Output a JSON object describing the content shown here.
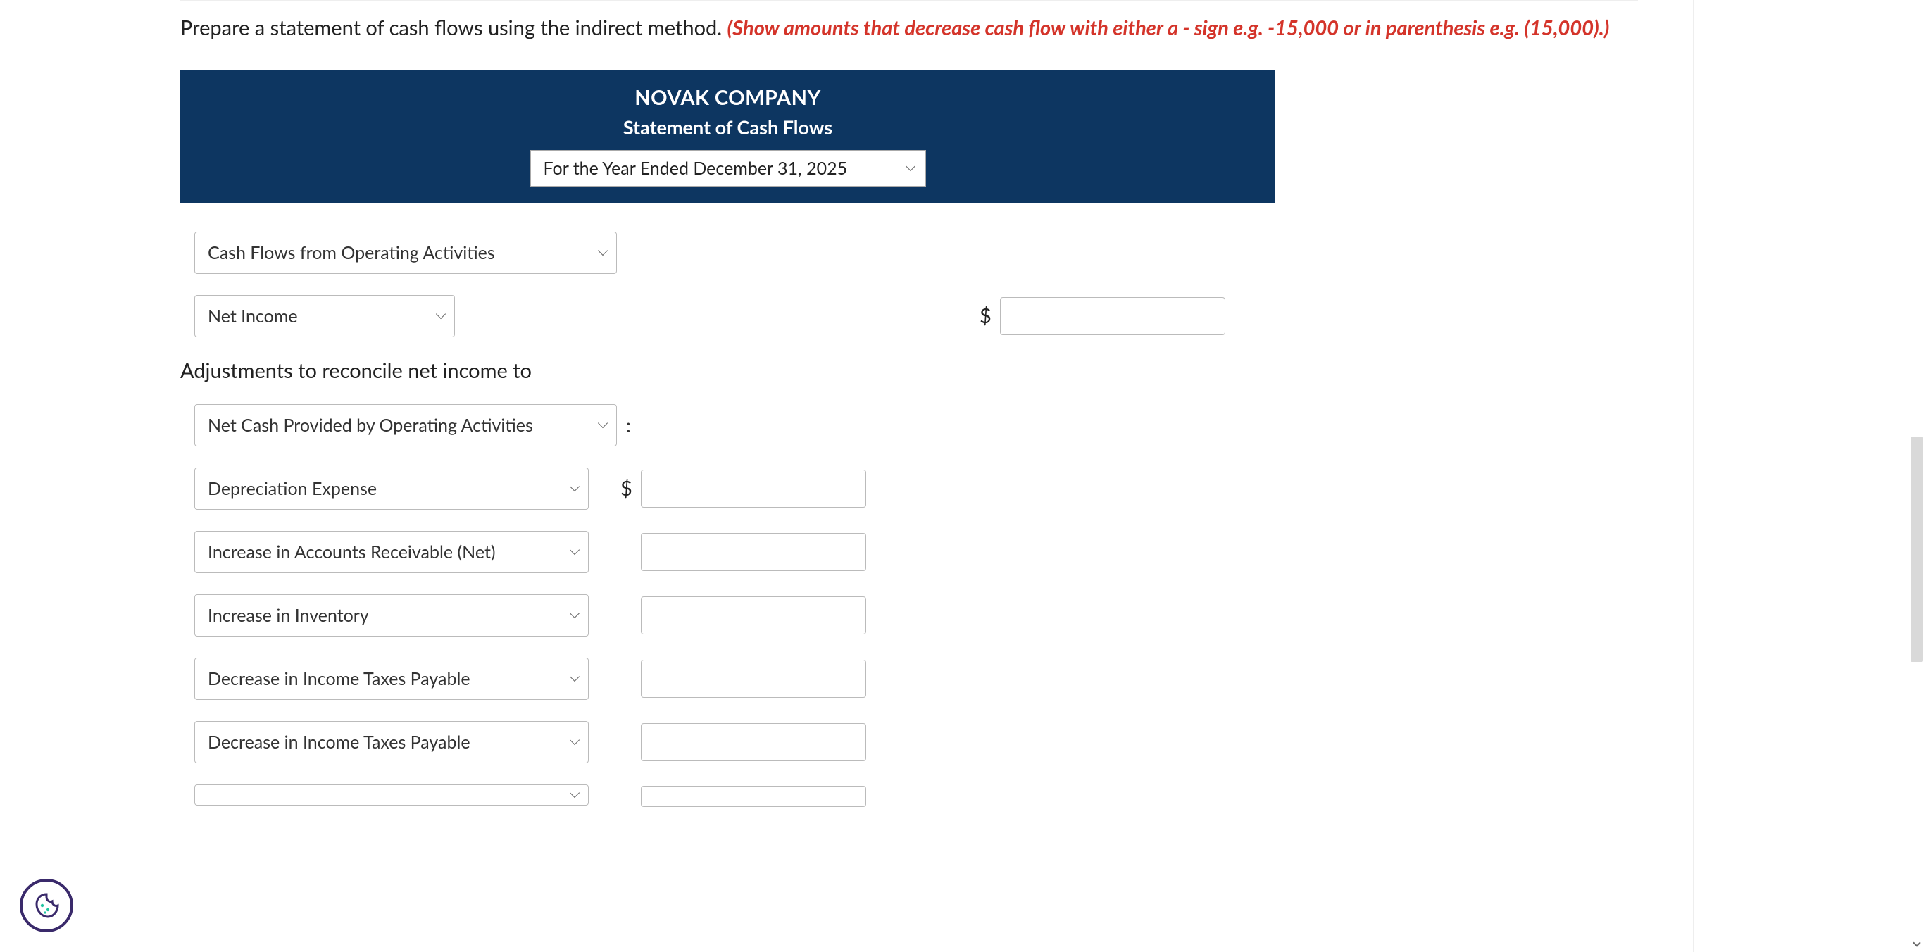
{
  "instructions": {
    "black": "Prepare a statement of cash flows using the indirect method. ",
    "red": "(Show amounts that decrease cash flow with either a - sign e.g. -15,000 or in parenthesis e.g. (15,000).)"
  },
  "header": {
    "company": "NOVAK COMPANY",
    "title": "Statement of Cash Flows",
    "period_selected": "For the Year Ended December 31, 2025"
  },
  "rows": {
    "section_select": "Cash Flows from Operating Activities",
    "net_income_select": "Net Income",
    "adjustments_label": "Adjustments to reconcile net income to",
    "net_cash_select": "Net Cash Provided by Operating Activities",
    "colon": ":",
    "depreciation_select": "Depreciation Expense",
    "ar_select": "Increase in Accounts Receivable (Net)",
    "inventory_select": "Increase in Inventory",
    "taxes1_select": "Decrease in Income Taxes Payable",
    "taxes2_select": "Decrease in Income Taxes Payable",
    "blank_select": " "
  },
  "symbols": {
    "dollar": "$"
  }
}
